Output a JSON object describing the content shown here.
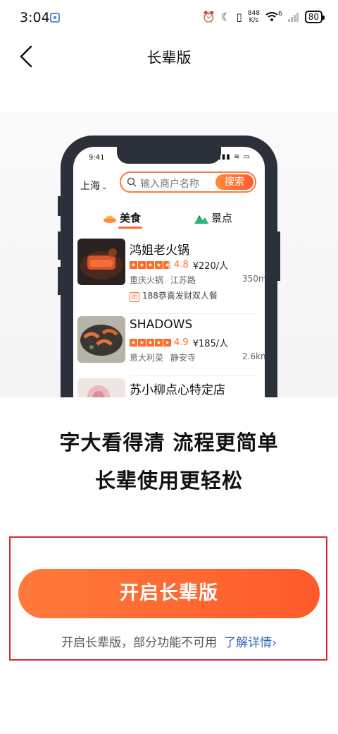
{
  "status_bar": {
    "time": "3:04",
    "net_speed_value": "848",
    "net_speed_unit": "K/s",
    "network": "6",
    "battery": "80"
  },
  "header": {
    "title": "长辈版"
  },
  "preview": {
    "time": "9:41",
    "city": "上海",
    "search_placeholder": "输入商户名称",
    "search_button": "搜索",
    "tabs": [
      {
        "label": "美食"
      },
      {
        "label": "景点"
      }
    ],
    "restaurants": [
      {
        "name": "鸿姐老火锅",
        "score": "4.8",
        "price": "¥220/人",
        "cuisine": "重庆火锅",
        "area": "江苏路",
        "distance": "350m",
        "promo": "188恭喜发财双人餐",
        "promo_badge": "团"
      },
      {
        "name": "SHADOWS",
        "score": "4.9",
        "price": "¥185/人",
        "cuisine": "意大利菜",
        "area": "静安寺",
        "distance": "2.6km"
      },
      {
        "name": "苏小柳点心特定店"
      }
    ]
  },
  "slogan": {
    "line1": "字大看得清 流程更简单",
    "line2": "长辈使用更轻松"
  },
  "cta": {
    "button": "开启长辈版",
    "note": "开启长辈版，部分功能不可用",
    "learn_more": "了解详情"
  },
  "colors": {
    "accent": "#ff6a2b",
    "link": "#2f68b8",
    "highlight_box": "#d9282f"
  }
}
